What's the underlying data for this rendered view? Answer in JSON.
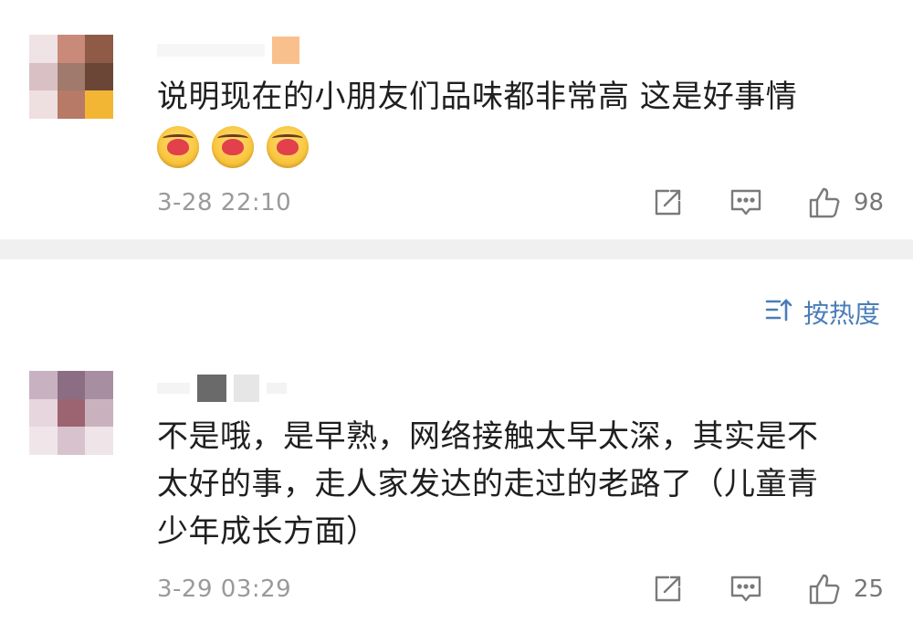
{
  "comments": [
    {
      "text": "说明现在的小朋友们品味都非常高 这是好事情",
      "emojis": [
        "hug-heart-emoji",
        "hug-heart-emoji",
        "hug-heart-emoji"
      ],
      "time": "3-28 22:10",
      "likes": "98",
      "avatar_colors": [
        "#efe3e6",
        "#c98a7a",
        "#8f5a46",
        "#d9c0c4",
        "#a07a6c",
        "#6b4636",
        "#eedfe0",
        "#b67a67",
        "#f3b534"
      ],
      "username_color": "#f9c08e"
    },
    {
      "text": "不是哦，是早熟，网络接触太早太深，其实是不\n太好的事，走人家发达的走过的老路了（儿童青\n少年成长方面）",
      "time": "3-29 03:29",
      "likes": "25",
      "avatar_colors": [
        "#c8b2c2",
        "#8b6e83",
        "#a78fa1",
        "#e7d6dd",
        "#9c6470",
        "#c9b1bd",
        "#f0e6ea",
        "#d8c2cd",
        "#efe4e8"
      ],
      "username_color": "#6a6a6a"
    }
  ],
  "sort": {
    "label": "按热度"
  },
  "colors": {
    "accent": "#4a7db8",
    "meta_gray": "#9a9a9a",
    "divider": "#f0f0f0"
  }
}
